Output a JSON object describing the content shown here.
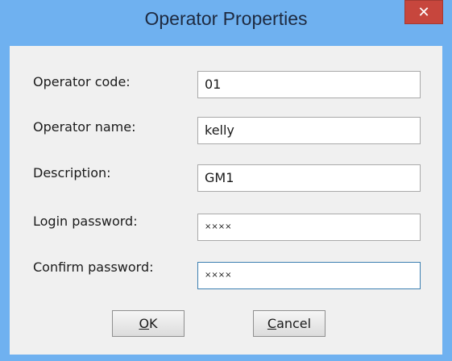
{
  "window": {
    "title": "Operator Properties",
    "close_glyph": "✕"
  },
  "form": {
    "fields": [
      {
        "label": "Operator code:",
        "value": "01"
      },
      {
        "label": "Operator name:",
        "value": "kelly"
      },
      {
        "label": "Description:",
        "value": "GM1"
      },
      {
        "label": "Login password:",
        "value": "××××"
      },
      {
        "label": "Confirm password:",
        "value": "××××"
      }
    ]
  },
  "buttons": {
    "ok_mnemonic": "O",
    "ok_rest": "K",
    "cancel_mnemonic": "C",
    "cancel_rest": "ancel"
  },
  "colors": {
    "titlebar": "#6fb1f0",
    "close_button": "#c7463d",
    "dialog_background": "#f0f0f0",
    "focus_border": "#3c7fb1"
  }
}
